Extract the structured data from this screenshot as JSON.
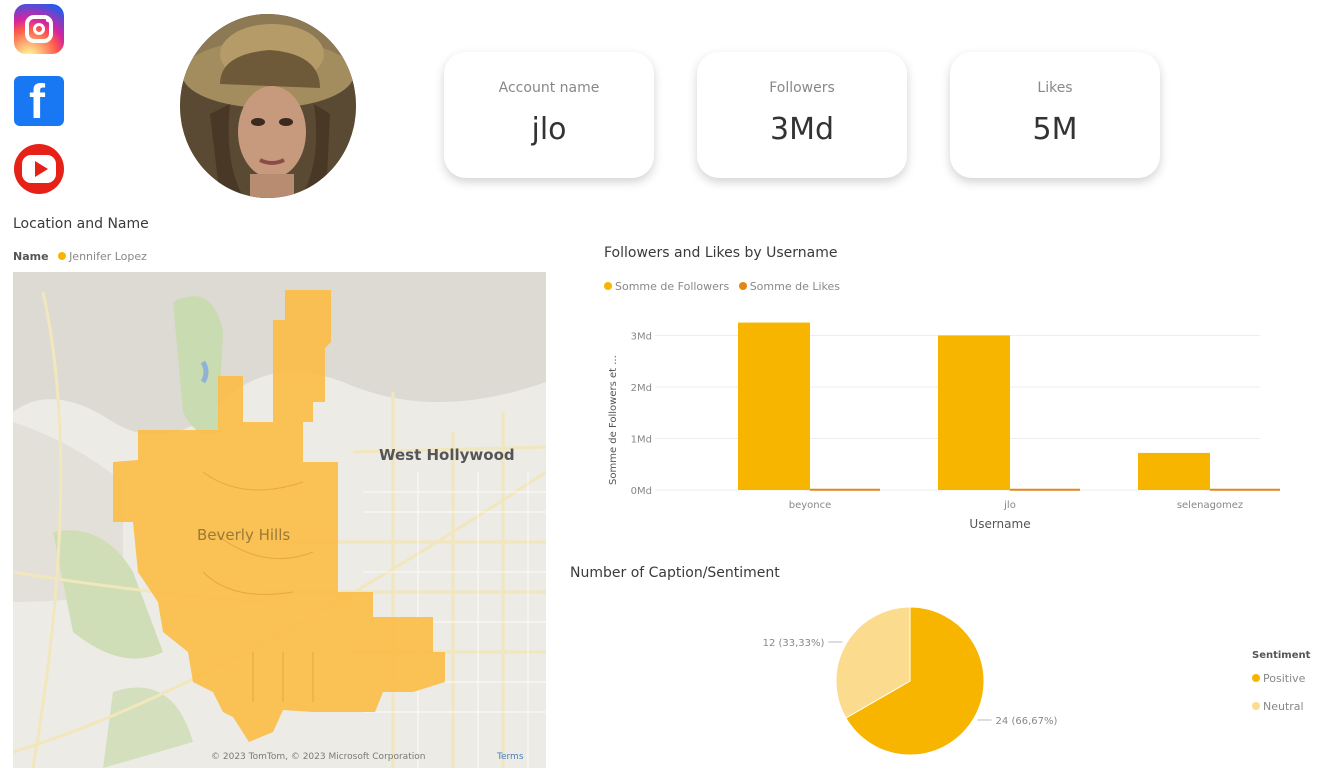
{
  "socials": {
    "instagram": "instagram-icon",
    "facebook": "facebook-icon",
    "youtube": "youtube-icon"
  },
  "kpis": [
    {
      "label": "Account name",
      "value": "jlo"
    },
    {
      "label": "Followers",
      "value": "3Md"
    },
    {
      "label": "Likes",
      "value": "5M"
    }
  ],
  "map_visual": {
    "title": "Location and Name",
    "legend_label": "Name",
    "legend_value": "Jennifer Lopez",
    "places": {
      "west_hollywood": "West Hollywood",
      "beverly_hills": "Beverly Hills"
    },
    "attribution": "© 2023 TomTom, © 2023 Microsoft Corporation",
    "terms": "Terms"
  },
  "colors": {
    "followers": "#f7b500",
    "likes": "#e3861a",
    "positive": "#f7b500",
    "neutral": "#fbdc8f",
    "highlight": "#fbbd48"
  },
  "chart_data": [
    {
      "type": "bar",
      "title": "Followers and Likes by Username",
      "legend": [
        "Somme de Followers",
        "Somme de Likes"
      ],
      "xlabel": "Username",
      "ylabel": "Somme de Followers et ...",
      "categories": [
        "beyonce",
        "jlo",
        "selenagomez"
      ],
      "yticks": [
        "0Md",
        "1Md",
        "2Md",
        "3Md"
      ],
      "ylim": [
        0,
        3.3
      ],
      "series": [
        {
          "name": "Somme de Followers",
          "values": [
            3.25,
            3.0,
            0.72
          ]
        },
        {
          "name": "Somme de Likes",
          "values": [
            0.005,
            0.005,
            0.005
          ]
        }
      ]
    },
    {
      "type": "pie",
      "title": "Number of Caption/Sentiment",
      "legend_title": "Sentiment",
      "labels": [
        "Positive",
        "Neutral"
      ],
      "values": [
        24,
        12
      ],
      "data_labels": [
        "24 (66,67%)",
        "12 (33,33%)"
      ]
    }
  ]
}
